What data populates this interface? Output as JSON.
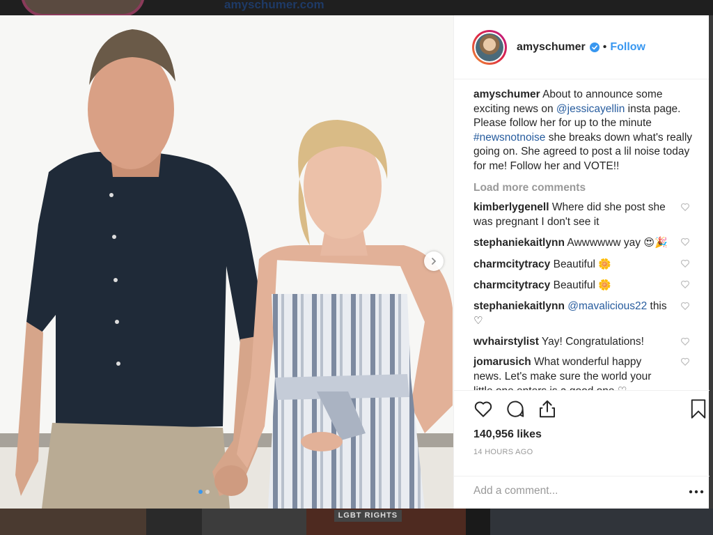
{
  "background": {
    "site_text": "amyschumer.com",
    "tile_text": "LGBT RIGHTS"
  },
  "post": {
    "username": "amyschumer",
    "follow_label": "Follow",
    "separator": "•",
    "caption": {
      "username": "amyschumer",
      "text_1": " About to announce some exciting news on ",
      "mention": "@jessicayellin",
      "text_2": " insta page. Please follow her for up to the minute ",
      "hashtag": "#newsnotnoise",
      "text_3": " she breaks down what's really going on. She agreed to post a lil noise today for me! Follow her and VOTE!!"
    },
    "load_more": "Load more comments",
    "comments": [
      {
        "user": "kimberlygenell",
        "text": " Where did she post she was pregnant I don't see it",
        "emoji": ""
      },
      {
        "user": "stephaniekaitlynn",
        "text": " Awwwwww yay ",
        "emoji": "😍🎉"
      },
      {
        "user": "charmcitytracy",
        "text": " Beautiful ",
        "emoji": "🌼"
      },
      {
        "user": "charmcitytracy",
        "text": " Beautiful ",
        "emoji": "🌼"
      },
      {
        "user": "stephaniekaitlynn",
        "mention": "@mavalicious22",
        "text": " this ",
        "emoji": "♡"
      },
      {
        "user": "wvhairstylist",
        "text": " Yay! Congratulations!",
        "emoji": ""
      },
      {
        "user": "jomarusich",
        "text": " What wonderful happy news. Let's make sure the world your little one enters is a good one ",
        "emoji": "♡"
      }
    ],
    "likes": "140,956 likes",
    "timestamp": "14 HOURS AGO",
    "comment_placeholder": "Add a comment...",
    "more_label": "•••"
  },
  "carousel": {
    "total": 2,
    "current": 1
  },
  "colors": {
    "accent": "#3897f0",
    "link": "#275c9e",
    "muted": "#999999"
  }
}
